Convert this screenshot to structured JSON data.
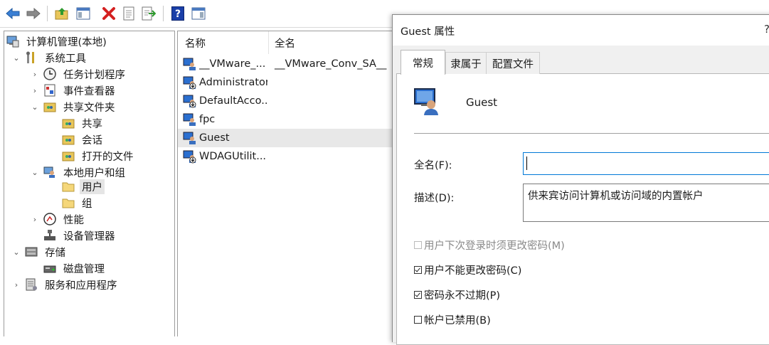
{
  "toolbar": {
    "buttons": [
      "back-icon",
      "forward-icon",
      "up-folder-icon",
      "show-hide-tree-icon",
      "delete-icon",
      "properties-icon",
      "export-list-icon",
      "help-icon",
      "show-action-pane-icon"
    ]
  },
  "tree": {
    "items": [
      {
        "label": "计算机管理(本地)",
        "icon": "computer-management-icon",
        "expander": ""
      },
      {
        "label": "系统工具",
        "icon": "system-tools-icon",
        "expander": "⌄"
      },
      {
        "label": "任务计划程序",
        "icon": "task-scheduler-icon",
        "expander": "›"
      },
      {
        "label": "事件查看器",
        "icon": "event-viewer-icon",
        "expander": "›"
      },
      {
        "label": "共享文件夹",
        "icon": "shared-folders-icon",
        "expander": "⌄"
      },
      {
        "label": "共享",
        "icon": "shares-icon",
        "expander": ""
      },
      {
        "label": "会话",
        "icon": "sessions-icon",
        "expander": ""
      },
      {
        "label": "打开的文件",
        "icon": "open-files-icon",
        "expander": ""
      },
      {
        "label": "本地用户和组",
        "icon": "local-users-groups-icon",
        "expander": "⌄"
      },
      {
        "label": "用户",
        "icon": "folder-icon",
        "expander": ""
      },
      {
        "label": "组",
        "icon": "folder-icon",
        "expander": ""
      },
      {
        "label": "性能",
        "icon": "performance-icon",
        "expander": "›"
      },
      {
        "label": "设备管理器",
        "icon": "device-manager-icon",
        "expander": ""
      },
      {
        "label": "存储",
        "icon": "storage-icon",
        "expander": "⌄"
      },
      {
        "label": "磁盘管理",
        "icon": "disk-management-icon",
        "expander": ""
      },
      {
        "label": "服务和应用程序",
        "icon": "services-apps-icon",
        "expander": "›"
      }
    ]
  },
  "list": {
    "columns": [
      "名称",
      "全名"
    ],
    "rows": [
      {
        "name": "__VMware_...",
        "full": "__VMware_Conv_SA__",
        "icon": "user-icon"
      },
      {
        "name": "Administrator",
        "full": "",
        "icon": "disabled-user-icon"
      },
      {
        "name": "DefaultAcco...",
        "full": "",
        "icon": "disabled-user-icon"
      },
      {
        "name": "fpc",
        "full": "",
        "icon": "user-icon"
      },
      {
        "name": "Guest",
        "full": "",
        "icon": "user-icon"
      },
      {
        "name": "WDAGUtilit...",
        "full": "",
        "icon": "disabled-user-icon"
      }
    ]
  },
  "dialog": {
    "title": "Guest 属性",
    "help": "?",
    "tabs": [
      "常规",
      "隶属于",
      "配置文件"
    ],
    "user_name": "Guest",
    "fullname_label": "全名(F):",
    "fullname_value": "",
    "desc_label": "描述(D):",
    "desc_value": "供来宾访问计算机或访问域的内置帐户",
    "checkboxes": [
      {
        "label": "用户下次登录时须更改密码(M)",
        "checked": false,
        "disabled": true
      },
      {
        "label": "用户不能更改密码(C)",
        "checked": true,
        "disabled": false
      },
      {
        "label": "密码永不过期(P)",
        "checked": true,
        "disabled": false
      },
      {
        "label": "帐户已禁用(B)",
        "checked": false,
        "disabled": false
      }
    ]
  },
  "colors": {
    "selection": "#e8e8e8",
    "focus_border": "#0078d7"
  }
}
